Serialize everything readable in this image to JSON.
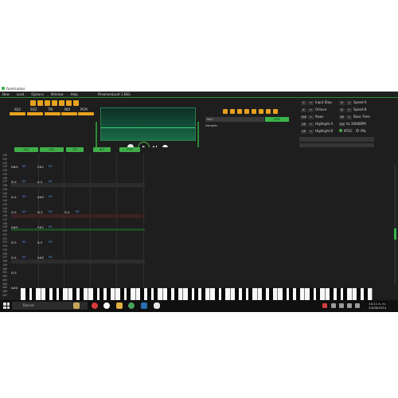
{
  "window": {
    "title": "Famitracker"
  },
  "menu": {
    "items": [
      "New",
      "Load",
      "Options",
      "Window",
      "Help"
    ],
    "file_label": "PinwheelLand 1.NSS"
  },
  "channels": [
    "SQ1",
    "SQ2",
    "TRI",
    "NOI",
    "PCM"
  ],
  "instrument": {
    "name": "No.1",
    "samples_label": "Samples",
    "button_label": "NTB"
  },
  "settings": {
    "input_step": {
      "label": "Input Step",
      "value": "1"
    },
    "octave": {
      "label": "Octave",
      "value": "4"
    },
    "rows": {
      "label": "Rows",
      "value": "256"
    },
    "highlight_a": {
      "label": "Highlight A",
      "value": "16"
    },
    "highlight_b": {
      "label": "Highlight B",
      "value": "16"
    },
    "speed_a": {
      "label": "Speed A",
      "value": "6"
    },
    "speed_b": {
      "label": "Speed B",
      "value": "6"
    },
    "base_time": {
      "label": "Base Time",
      "value": "16"
    },
    "tempo": {
      "label": "hz",
      "value": "120",
      "bpm": "3000BPM"
    },
    "region": {
      "ntsc": "NTSC",
      "pal": "PAL"
    }
  },
  "tracker": {
    "row_numbers": [
      "130",
      "131",
      "132",
      "133",
      "134",
      "135",
      "136",
      "137",
      "138",
      "139",
      "140",
      "141",
      "142",
      "143",
      "144",
      "145",
      "146",
      "147",
      "148",
      "149",
      "150",
      "151",
      "152",
      "153",
      "154",
      "155",
      "156",
      "157",
      "158",
      "159",
      "160",
      "161",
      "162",
      "163",
      "164",
      "165",
      "166",
      "167"
    ],
    "notes": [
      {
        "row": 3,
        "col": 0,
        "note": "D#5",
        "vel": "00"
      },
      {
        "row": 3,
        "col": 1,
        "note": "F#2",
        "vel": "00"
      },
      {
        "row": 7,
        "col": 0,
        "note": "D-5",
        "vel": "00"
      },
      {
        "row": 7,
        "col": 1,
        "note": "A-2",
        "vel": "00"
      },
      {
        "row": 11,
        "col": 0,
        "note": "G-4",
        "vel": "00"
      },
      {
        "row": 11,
        "col": 1,
        "note": "A#2",
        "vel": "00"
      },
      {
        "row": 15,
        "col": 0,
        "note": "G-5",
        "vel": "00"
      },
      {
        "row": 15,
        "col": 1,
        "note": "D-2",
        "vel": "00"
      },
      {
        "row": 15,
        "col": 2,
        "note": "G-2",
        "vel": "00"
      },
      {
        "row": 19,
        "col": 0,
        "note": "D#5",
        "vel": ""
      },
      {
        "row": 19,
        "col": 1,
        "note": "F#2",
        "vel": "00"
      },
      {
        "row": 23,
        "col": 0,
        "note": "D-5",
        "vel": "00"
      },
      {
        "row": 23,
        "col": 1,
        "note": "A-2",
        "vel": "00"
      },
      {
        "row": 27,
        "col": 0,
        "note": "G-4",
        "vel": "00"
      },
      {
        "row": 27,
        "col": 1,
        "note": "A#2",
        "vel": "00"
      },
      {
        "row": 31,
        "col": 0,
        "note": "D-5",
        "vel": ""
      },
      {
        "row": 35,
        "col": 0,
        "note": "A#4",
        "vel": ""
      }
    ]
  },
  "taskbar": {
    "search_placeholder": "Buscar",
    "time": "10:11 a. m.",
    "date": "24/06/2024"
  },
  "colors": {
    "accent": "#3fae49",
    "orange": "#e8a21e",
    "velocity": "#5aa0ff"
  }
}
